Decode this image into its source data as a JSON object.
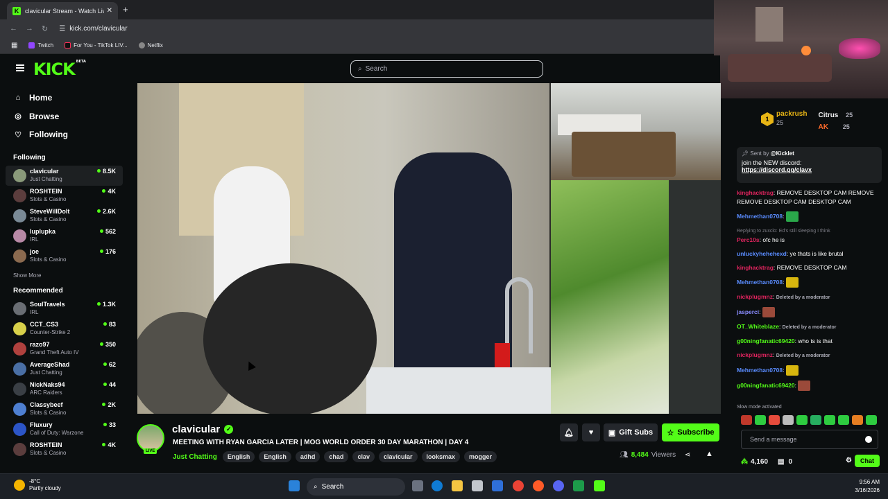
{
  "browser": {
    "tab_title": "clavicular Stream - Watch Live on Kick",
    "url": "kick.com/clavicular",
    "bookmarks": [
      "Twitch",
      "For You - TikTok LIV...",
      "Netflix"
    ]
  },
  "nav": {
    "logo": "KICK",
    "beta": "BETA",
    "search_placeholder": "Search"
  },
  "sidebar": {
    "main": [
      {
        "label": "Home",
        "icon": "home-icon"
      },
      {
        "label": "Browse",
        "icon": "compass-icon"
      },
      {
        "label": "Following",
        "icon": "heart-icon"
      }
    ],
    "following_title": "Following",
    "following": [
      {
        "name": "clavicular",
        "cat": "Just Chatting",
        "viewers": "8.5K",
        "color": "#8a9a7a"
      },
      {
        "name": "ROSHTEIN",
        "cat": "Slots & Casino",
        "viewers": "4K",
        "color": "#5b3d3d"
      },
      {
        "name": "SteveWillDoIt",
        "cat": "Slots & Casino",
        "viewers": "2.6K",
        "color": "#7a8a96"
      },
      {
        "name": "luplupka",
        "cat": "IRL",
        "viewers": "562",
        "color": "#b889a6"
      },
      {
        "name": "joe",
        "cat": "Slots & Casino",
        "viewers": "176",
        "color": "#8b6a4f"
      }
    ],
    "show_more": "Show More",
    "rec_title": "Recommended",
    "recommended": [
      {
        "name": "SoulTravels",
        "cat": "IRL",
        "viewers": "1.3K",
        "color": "#6a6e74"
      },
      {
        "name": "CCT_CS3",
        "cat": "Counter-Strike 2",
        "viewers": "83",
        "color": "#d8d04a"
      },
      {
        "name": "razo97",
        "cat": "Grand Theft Auto IV",
        "viewers": "350",
        "color": "#b0413e"
      },
      {
        "name": "AverageShad",
        "cat": "Just Chatting",
        "viewers": "62",
        "color": "#4a6fa5"
      },
      {
        "name": "NickNaks94",
        "cat": "ARC Raiders",
        "viewers": "44",
        "color": "#3a3f45"
      },
      {
        "name": "Classybeef",
        "cat": "Slots & Casino",
        "viewers": "2K",
        "color": "#4e7fd1"
      },
      {
        "name": "Fluxury",
        "cat": "Call of Duty: Warzone",
        "viewers": "33",
        "color": "#2c55c7"
      },
      {
        "name": "ROSHTEIN",
        "cat": "Slots & Casino",
        "viewers": "4K",
        "color": "#5b3d3d"
      }
    ]
  },
  "stream": {
    "name": "clavicular",
    "live": "LIVE",
    "title": "MEETING WITH RYAN GARCIA LATER | MOG WORLD ORDER 30 DAY MARATHON | DAY 4",
    "category": "Just Chatting",
    "tags": [
      "English",
      "English",
      "adhd",
      "chad",
      "clav",
      "clavicular",
      "looksmax",
      "mogger"
    ],
    "gift": "Gift Subs",
    "subscribe": "Subscribe",
    "viewers": "8,484",
    "viewers_label": "Viewers"
  },
  "chat": {
    "leaderboard": [
      {
        "name": "packrush",
        "val": "25"
      },
      {
        "name": "Citrus",
        "val": "25"
      },
      {
        "name": "AK",
        "val": "25"
      }
    ],
    "rank": "1",
    "pinned_by": "Sent by",
    "pinned_user": "@Kicklet",
    "pinned_text": "join the NEW discord:",
    "pinned_link": "https://discord.gg/clavx",
    "messages": [
      {
        "user": "kinghacktrag",
        "color": "#e0245e",
        "text": "REMOVE DESKTOP CAM REMOVE REMOVE DESKTOP CAM DESKTOP CAM"
      },
      {
        "user": "Mehmethan0708",
        "color": "#5a8cff",
        "text": "",
        "emote": "#2aa84a"
      },
      {
        "user": "Perc10s",
        "color": "#e0245e",
        "text": "ofc he is",
        "reply": "Replying to zuxclo: Ed's still sleeping I think"
      },
      {
        "user": "unluckyhehehexd",
        "color": "#5a8cff",
        "text": "ye thats is like brutal"
      },
      {
        "user": "kinghacktrag",
        "color": "#e0245e",
        "text": "REMOVE DESKTOP CAM"
      },
      {
        "user": "Mehmethan0708",
        "color": "#5a8cff",
        "text": "",
        "emote": "#d8b60e"
      },
      {
        "user": "nickplugmnz",
        "color": "#e0245e",
        "text": "Deleted by a moderator",
        "deleted": true
      },
      {
        "user": "jasperci",
        "color": "#8a8cff",
        "text": "",
        "emote": "#9b4a3a"
      },
      {
        "user": "OT_Whiteblaze",
        "color": "#53fc18",
        "text": "Deleted by a moderator",
        "deleted": true
      },
      {
        "user": "g00ningfanatic69420",
        "color": "#53fc18",
        "text": "who ts is that"
      },
      {
        "user": "nickplugmnz",
        "color": "#e0245e",
        "text": "Deleted by a moderator",
        "deleted": true
      },
      {
        "user": "Mehmethan0708",
        "color": "#5a8cff",
        "text": "",
        "emote": "#d8b60e"
      },
      {
        "user": "g00ningfanatic69420",
        "color": "#53fc18",
        "text": "",
        "emote": "#9b4a3a"
      }
    ],
    "slow_mode": "Slow mode activated",
    "input_placeholder": "Send a message",
    "points": "4,160",
    "gifts": "0",
    "chat_btn": "Chat"
  },
  "taskbar": {
    "temp": "-8°C",
    "weather": "Partly cloudy",
    "search": "Search",
    "time": "9:56 AM",
    "date": "3/16/2026"
  }
}
